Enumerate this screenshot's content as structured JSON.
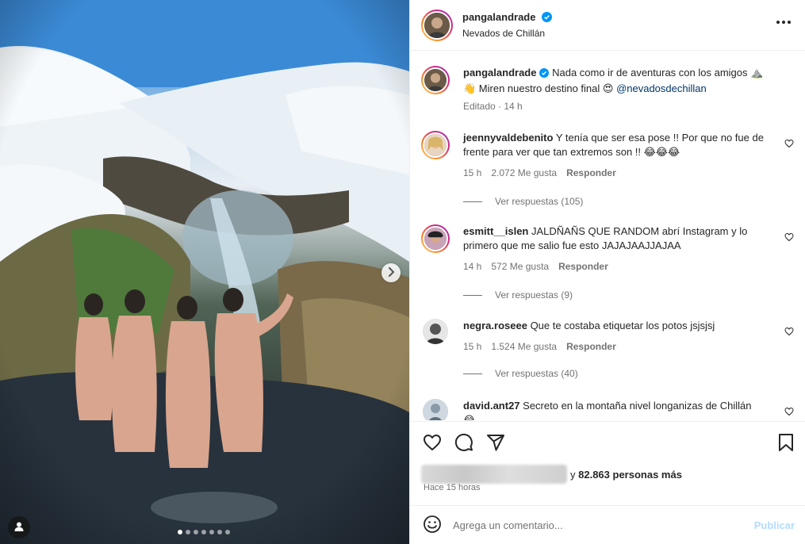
{
  "post": {
    "author": "pangalandrade",
    "location": "Nevados de Chillán",
    "photo_count": 7,
    "active_photo": 1
  },
  "caption": {
    "username": "pangalandrade",
    "text_a": "Nada como ir de aventuras con los amigos ⛰️",
    "text_b": "👋 Miren nuestro destino final 😍",
    "mention": "@nevadosdechillan",
    "meta": "Editado · 14 h"
  },
  "comments": [
    {
      "username": "jeennyvaldebenito",
      "text_a": "Y tenía que ser esa pose !! Por que no fue de",
      "text_b": "frente para ver que tan extremos son !! 😂😂😂",
      "time": "15 h",
      "likes": "2.072 Me gusta",
      "reply": "Responder",
      "view_replies": "Ver respuestas (105)"
    },
    {
      "username": "esmitt__islen",
      "text_a": "JALDÑAÑS QUE RANDOM abrí Instagram y lo",
      "text_b": "primero que me salio fue esto JAJAJAAJJAJAA",
      "time": "14 h",
      "likes": "572 Me gusta",
      "reply": "Responder",
      "view_replies": "Ver respuestas (9)"
    },
    {
      "username": "negra.roseee",
      "text_a": "Que te costaba etiquetar los potos jsjsjsj",
      "time": "15 h",
      "likes": "1.524 Me gusta",
      "reply": "Responder",
      "view_replies": "Ver respuestas (40)"
    },
    {
      "username": "david.ant27",
      "text_a": "Secreto en la montaña nivel longanizas de Chillán",
      "text_b": "😂"
    }
  ],
  "likes_summary": {
    "suffix": "y",
    "count": "82.863 personas más"
  },
  "posted_time": "Hace 15 horas",
  "add_comment": {
    "placeholder": "Agrega un comentario...",
    "publish": "Publicar"
  },
  "colors": {
    "accent_blue": "#0095f6",
    "publish_disabled": "#b3dbff",
    "verified": "#0095f6",
    "meta_gray": "#737373"
  },
  "icons": [
    "verified-badge-icon",
    "more-options-icon",
    "heart-icon",
    "comment-icon",
    "share-icon",
    "bookmark-icon",
    "emoji-icon",
    "user-tag-icon",
    "chevron-right-icon"
  ]
}
